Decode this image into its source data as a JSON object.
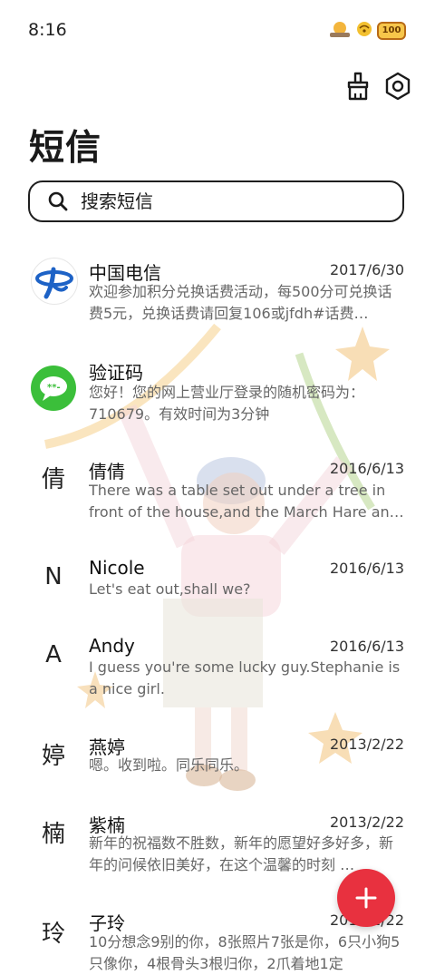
{
  "status": {
    "time": "8:16",
    "battery": "100"
  },
  "header": {
    "title": "短信"
  },
  "search": {
    "placeholder": "搜索短信"
  },
  "messages": [
    {
      "sender": "中国电信",
      "date": "2017/6/30",
      "preview": "欢迎参加积分兑换话费活动，每500分可兑换话费5元，兑换话费请回复106或jfdh#话费…",
      "avatar": ""
    },
    {
      "sender": "验证码",
      "date": "",
      "preview": "您好！您的网上营业厅登录的随机密码为：710679。有效时间为3分钟",
      "avatar": ""
    },
    {
      "sender": "倩倩",
      "date": "2016/6/13",
      "preview": "There was a table set out under a tree in front of the house,and the March Hare an…",
      "avatar": "倩"
    },
    {
      "sender": "Nicole",
      "date": "2016/6/13",
      "preview": "Let's eat out,shall we?",
      "avatar": "N"
    },
    {
      "sender": "Andy",
      "date": "2016/6/13",
      "preview": "I guess you're some lucky guy.Stephanie is a nice girl.",
      "avatar": "A"
    },
    {
      "sender": "燕婷",
      "date": "2013/2/22",
      "preview": "嗯。收到啦。同乐同乐。",
      "avatar": "婷"
    },
    {
      "sender": "紫楠",
      "date": "2013/2/22",
      "preview": "新年的祝福数不胜数，新年的愿望好多好多，新年的问候依旧美好，在这个温馨的时刻 …",
      "avatar": "楠"
    },
    {
      "sender": "子玲",
      "date": "2013/2/22",
      "preview": "10分想念9别的你，8张照片7张是你，6只小狗5只像你，4根骨头3根归你，2爪着地1定",
      "avatar": "玲"
    }
  ],
  "colors": {
    "fab": "#e8313f",
    "telecom": "#1d62c6",
    "sms_green": "#3bbf3a"
  }
}
